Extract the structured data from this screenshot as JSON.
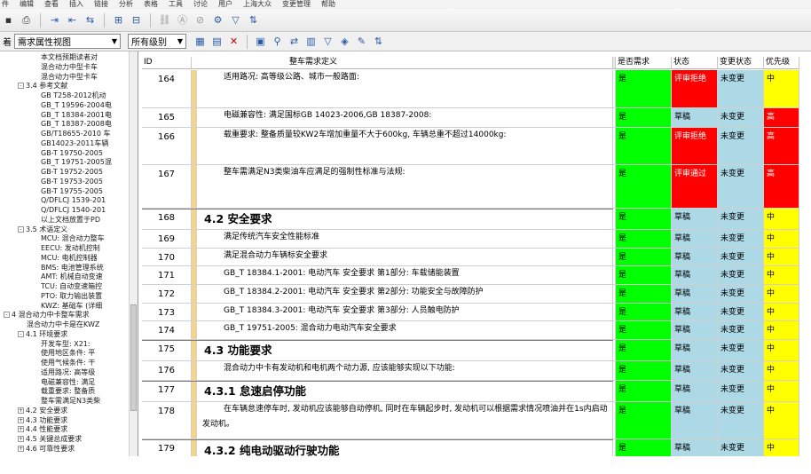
{
  "menu": [
    "件",
    "编辑",
    "查看",
    "插入",
    "链接",
    "分析",
    "表格",
    "工具",
    "讨论",
    "用户",
    "上海大众",
    "变更管理",
    "帮助"
  ],
  "toolbar_icons": [
    "save-icon",
    "print-icon",
    "indent-icon",
    "outdent-icon",
    "move-icon",
    "insert-object-icon",
    "insert-object-below-icon",
    "link-icon",
    "format-icon",
    "unlink-icon",
    "attribute-icon",
    "filter-icon",
    "sort-icon"
  ],
  "viewbar": {
    "label": "着",
    "view_select": "需求属性视图",
    "level_select": "所有级别"
  },
  "tree": [
    {
      "text": "本文档预期读者对",
      "indent": 46
    },
    {
      "text": "混合动力中型卡车",
      "indent": 46
    },
    {
      "text": "混合动力中型卡车",
      "indent": 46
    },
    {
      "text": "3.4 参考文献",
      "indent": 30,
      "exp": "-"
    },
    {
      "text": "GB T258-2012机动",
      "indent": 46
    },
    {
      "text": "GB_T 19596-2004电",
      "indent": 46
    },
    {
      "text": "GB_T 18384-2001电",
      "indent": 46
    },
    {
      "text": "GB_T 18387-2008电",
      "indent": 46
    },
    {
      "text": "GB/T18655-2010 车",
      "indent": 46
    },
    {
      "text": "GB14023-2011车辆",
      "indent": 46
    },
    {
      "text": "GB-T 19750-2005",
      "indent": 46
    },
    {
      "text": "GB_T 19751-2005混",
      "indent": 46
    },
    {
      "text": "GB-T 19752-2005",
      "indent": 46
    },
    {
      "text": "GB-T 19753-2005",
      "indent": 46
    },
    {
      "text": "GB-T 19755-2005",
      "indent": 46
    },
    {
      "text": "Q/DFLCJ 1539-201",
      "indent": 46
    },
    {
      "text": "Q/DFLCJ 1540-201",
      "indent": 46
    },
    {
      "text": "以上文档放置于PD",
      "indent": 46
    },
    {
      "text": "3.5 术语定义",
      "indent": 30,
      "exp": "-"
    },
    {
      "text": "MCU: 混合动力整车",
      "indent": 46
    },
    {
      "text": "EECU: 发动机控制",
      "indent": 46
    },
    {
      "text": "MCU: 电机控制器",
      "indent": 46
    },
    {
      "text": "BMS: 电池管理系统",
      "indent": 46
    },
    {
      "text": "AMT: 机械自动变速",
      "indent": 46
    },
    {
      "text": "TCU: 自动变速箱控",
      "indent": 46
    },
    {
      "text": "PTO: 取力输出装置",
      "indent": 46
    },
    {
      "text": "KWZ: 基础车 (详细",
      "indent": 46
    },
    {
      "text": "4 混合动力中卡整车需求",
      "indent": 14,
      "exp": "-"
    },
    {
      "text": "混合动力中卡是在KWZ",
      "indent": 30
    },
    {
      "text": "4.1 环境要求",
      "indent": 30,
      "exp": "-"
    },
    {
      "text": "开发车型: X21:",
      "indent": 46
    },
    {
      "text": "使用地区条件: 平",
      "indent": 46
    },
    {
      "text": "使用气候条件: 干",
      "indent": 46
    },
    {
      "text": "适用路况: 高等级",
      "indent": 46
    },
    {
      "text": "电磁兼容性: 满足",
      "indent": 46
    },
    {
      "text": "载重要求: 整备质",
      "indent": 46
    },
    {
      "text": "整车需满足N3类柴",
      "indent": 46
    },
    {
      "text": "4.2 安全要求",
      "indent": 30,
      "exp": "+"
    },
    {
      "text": "4.3 功能要求",
      "indent": 30,
      "exp": "+"
    },
    {
      "text": "4.4 性能要求",
      "indent": 30,
      "exp": "+"
    },
    {
      "text": "4.5 关键总成要求",
      "indent": 30,
      "exp": "+"
    },
    {
      "text": "4.6 可靠性要求",
      "indent": 30,
      "exp": "+"
    }
  ],
  "grid": {
    "headers": {
      "id": "ID",
      "def": "整车需求定义",
      "req": "是否需求",
      "status": "状态",
      "chg": "变更状态",
      "pri": "优先级"
    },
    "rows": [
      {
        "id": "164",
        "def": "适用路况: 高等级公路、城市一般路面:",
        "req": "是",
        "status": "评审拒绝",
        "status_color": "red",
        "chg": "未变更",
        "pri": "中",
        "pri_color": "yellow",
        "h": 43,
        "style": "indent"
      },
      {
        "id": "165",
        "def": "电磁兼容性: 满足国标GB 14023-2006,GB 18387-2008:",
        "req": "是",
        "status": "草稿",
        "status_color": "blue",
        "chg": "未变更",
        "pri": "高",
        "pri_color": "red",
        "h": 22,
        "style": "indent"
      },
      {
        "id": "166",
        "def": "载重要求: 整备质量较KW2车增加重量不大于600kg, 车辆总重不超过14000kg:",
        "req": "是",
        "status": "评审拒绝",
        "status_color": "red",
        "chg": "未变更",
        "pri": "高",
        "pri_color": "red",
        "h": 42,
        "style": "indent"
      },
      {
        "id": "167",
        "def": "整车需满足N3类柴油车应满足的强制性标准与法规:",
        "req": "是",
        "status": "评审通过",
        "status_color": "red",
        "chg": "未变更",
        "pri": "高",
        "pri_color": "red",
        "h": 49,
        "style": "indent"
      },
      {
        "id": "168",
        "def": "4.2 安全要求",
        "req": "是",
        "status": "草稿",
        "status_color": "blue",
        "chg": "未变更",
        "pri": "中",
        "pri_color": "yellow",
        "h": 24,
        "style": "heading"
      },
      {
        "id": "169",
        "def": "满足传统汽车安全性能标准",
        "req": "是",
        "status": "草稿",
        "status_color": "blue",
        "chg": "未变更",
        "pri": "中",
        "pri_color": "yellow",
        "h": 21,
        "style": "indent"
      },
      {
        "id": "170",
        "def": "满足混合动力车辆标安全要求",
        "req": "是",
        "status": "草稿",
        "status_color": "blue",
        "chg": "未变更",
        "pri": "中",
        "pri_color": "yellow",
        "h": 20,
        "style": "indent"
      },
      {
        "id": "171",
        "def": "GB_T 18384.1-2001: 电动汽车 安全要求 第1部分: 车载储能装置",
        "req": "是",
        "status": "草稿",
        "status_color": "blue",
        "chg": "未变更",
        "pri": "中",
        "pri_color": "yellow",
        "h": 21,
        "style": "indent"
      },
      {
        "id": "172",
        "def": "GB_T 18384.2-2001: 电动汽车 安全要求 第2部分: 功能安全与故障防护",
        "req": "是",
        "status": "草稿",
        "status_color": "blue",
        "chg": "未变更",
        "pri": "中",
        "pri_color": "yellow",
        "h": 21,
        "style": "indent"
      },
      {
        "id": "173",
        "def": "GB_T 18384.3-2001: 电动汽车 安全要求 第3部分: 人员触电防护",
        "req": "是",
        "status": "草稿",
        "status_color": "blue",
        "chg": "未变更",
        "pri": "中",
        "pri_color": "yellow",
        "h": 20,
        "style": "indent"
      },
      {
        "id": "174",
        "def": "GB_T 19751-2005:   混合动力电动汽车安全要求",
        "req": "是",
        "status": "草稿",
        "status_color": "blue",
        "chg": "未变更",
        "pri": "中",
        "pri_color": "yellow",
        "h": 21,
        "style": "indent"
      },
      {
        "id": "175",
        "def": "4.3 功能要求",
        "req": "是",
        "status": "草稿",
        "status_color": "blue",
        "chg": "未变更",
        "pri": "中",
        "pri_color": "yellow",
        "h": 24,
        "style": "heading"
      },
      {
        "id": "176",
        "def": "混合动力中卡有发动机和电机两个动力源, 应该能够实现以下功能:",
        "req": "是",
        "status": "草稿",
        "status_color": "blue",
        "chg": "未变更",
        "pri": "中",
        "pri_color": "yellow",
        "h": 22,
        "style": "indent"
      },
      {
        "id": "177",
        "def": "4.3.1 怠速启停功能",
        "req": "是",
        "status": "草稿",
        "status_color": "blue",
        "chg": "未变更",
        "pri": "中",
        "pri_color": "yellow",
        "h": 24,
        "style": "heading"
      },
      {
        "id": "178",
        "def": "在车辆怠速停车时, 发动机应该能够自动停机, 同时在车辆起步时, 发动机可以根据需求情况喷油并在1s内启动发动机。",
        "req": "是",
        "status": "草稿",
        "status_color": "blue",
        "chg": "未变更",
        "pri": "中",
        "pri_color": "yellow",
        "h": 42,
        "style": "wrap"
      },
      {
        "id": "179",
        "def": "4.3.2 纯电动驱动行驶功能",
        "req": "是",
        "status": "草稿",
        "status_color": "blue",
        "chg": "未变更",
        "pri": "中",
        "pri_color": "yellow",
        "h": 26,
        "style": "heading"
      }
    ]
  }
}
